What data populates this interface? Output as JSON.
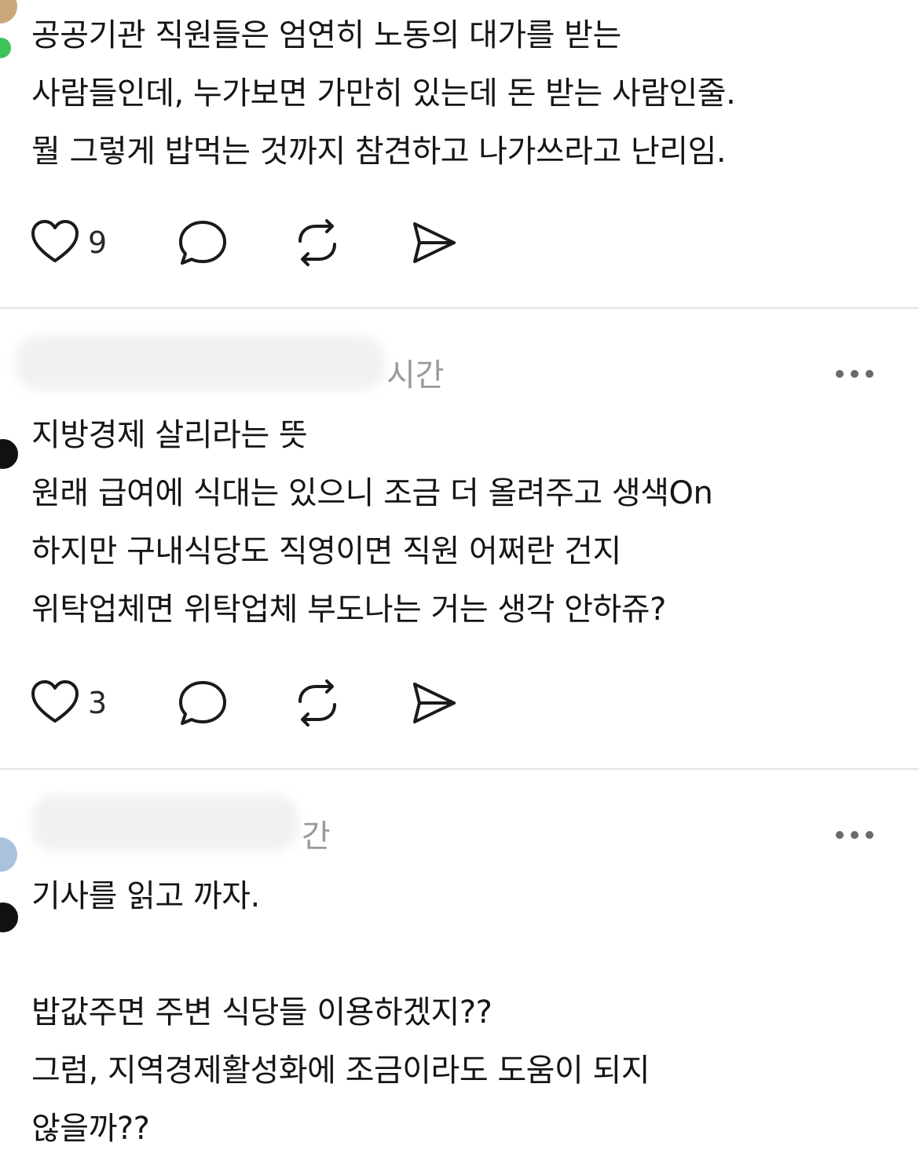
{
  "posts": [
    {
      "text": "공공기관 직원들은 엄연히 노동의 대가를 받는\n사람들인데, 누가보면 가만히 있는데 돈 받는 사람인줄.\n뭘 그렇게 밥먹는 것까지 참견하고 나가쓰라고 난리임.",
      "likes": "9"
    },
    {
      "time": "시간",
      "text": "지방경제 살리라는 뜻\n원래 급여에 식대는 있으니 조금 더 올려주고 생색On\n하지만 구내식당도 직영이면 직원 어쩌란 건지\n위탁업체면 위탁업체 부도나는 거는 생각 안하쥬?",
      "likes": "3"
    },
    {
      "time": "간",
      "text": "기사를 읽고 까자.\n\n밥값주면 주변 식당들 이용하겠지??\n그럼, 지역경제활성화에 조금이라도 도움이 되지\n않을까??"
    }
  ],
  "icons": {
    "like": "heart-icon",
    "reply": "comment-bubble-icon",
    "repost": "repost-icon",
    "share": "send-icon",
    "more": "more-dots-icon"
  },
  "colors": {
    "text": "#151515",
    "muted": "#9a9a9a",
    "divider": "#e3e3e3"
  }
}
